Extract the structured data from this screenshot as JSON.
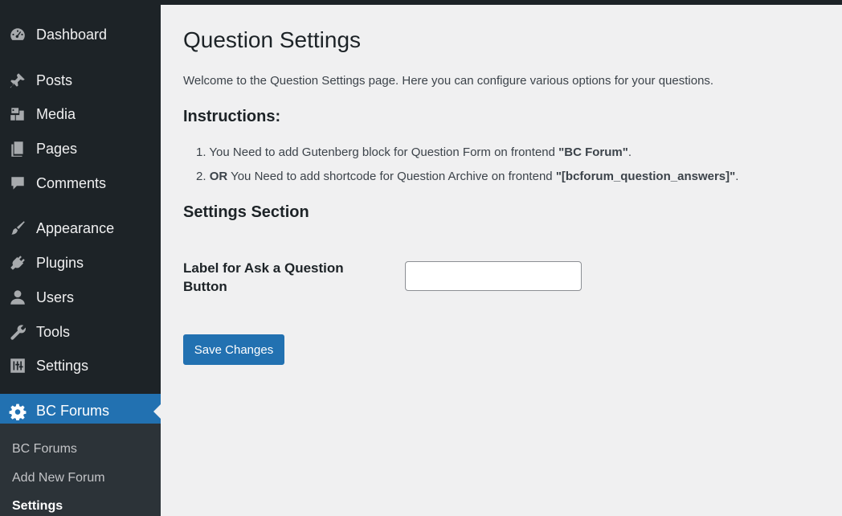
{
  "sidebar": {
    "items": [
      {
        "label": "Dashboard",
        "icon": "dashboard-icon"
      },
      {
        "label": "Posts",
        "icon": "pin-icon"
      },
      {
        "label": "Media",
        "icon": "media-icon"
      },
      {
        "label": "Pages",
        "icon": "pages-icon"
      },
      {
        "label": "Comments",
        "icon": "comment-icon"
      },
      {
        "label": "Appearance",
        "icon": "brush-icon"
      },
      {
        "label": "Plugins",
        "icon": "plugin-icon"
      },
      {
        "label": "Users",
        "icon": "user-icon"
      },
      {
        "label": "Tools",
        "icon": "wrench-icon"
      },
      {
        "label": "Settings",
        "icon": "sliders-icon"
      },
      {
        "label": "BC Forums",
        "icon": "gear-icon"
      }
    ],
    "submenu": [
      {
        "label": "BC Forums"
      },
      {
        "label": "Add New Forum"
      },
      {
        "label": "Settings"
      }
    ]
  },
  "main": {
    "title": "Question Settings",
    "intro": "Welcome to the Question Settings page. Here you can configure various options for your questions.",
    "instructions_heading": "Instructions:",
    "instructions": [
      {
        "num": "1.",
        "pre": "You Need to add Gutenberg block for Question Form on frontend ",
        "bold": "\"BC Forum\"",
        "post": "."
      },
      {
        "num": "2.",
        "lead": "OR",
        "pre": " You Need to add shortcode for Question Archive on frontend ",
        "bold": "\"[bcforum_question_answers]\"",
        "post": "."
      }
    ],
    "settings_heading": "Settings Section",
    "field_label": "Label for Ask a Question Button",
    "field_value": "",
    "save_label": "Save Changes"
  },
  "colors": {
    "sidebar_bg": "#1d2327",
    "submenu_bg": "#2c3338",
    "accent": "#2271b1",
    "content_bg": "#f0f0f1"
  }
}
